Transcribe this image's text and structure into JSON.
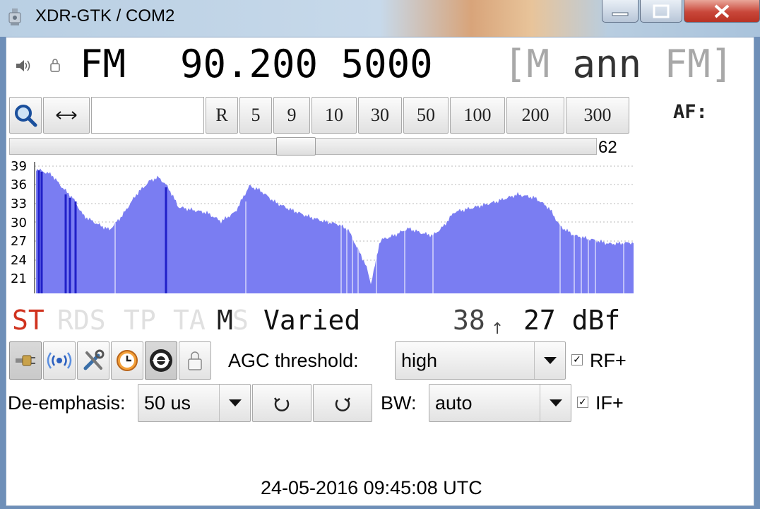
{
  "window": {
    "title": "XDR-GTK / COM2",
    "buttons": {
      "minimize": "minimize-icon",
      "maximize": "maximize-icon",
      "close": "close-icon"
    }
  },
  "tuner": {
    "mode": "FM",
    "frequency": "90.200",
    "pi_code": "5000",
    "station_bracket_open": "[",
    "station_m": "M",
    "station_ann": "ann",
    "station_fm": "FM",
    "station_bracket_close": "]",
    "af_label": "AF:"
  },
  "tune_buttons": {
    "scan_icon": "magnifier-icon",
    "swap_icon": "arrows-horizontal-icon",
    "freq_input_value": "",
    "steps": [
      "R",
      "5",
      "9",
      "10",
      "30",
      "50",
      "100",
      "200",
      "300"
    ]
  },
  "slider": {
    "value": "62"
  },
  "graph": {
    "y_ticks": [
      "39",
      "36",
      "33",
      "30",
      "27",
      "24",
      "21"
    ],
    "color": "#7a7df2",
    "marker_color": "#2020c8"
  },
  "status": {
    "st": "ST",
    "rds": "RDS",
    "tp": "TP",
    "ta": "TA",
    "m": "M",
    "s": "S",
    "ps": "Varied",
    "signal": "38",
    "signal_arrow": "↑",
    "dbf": "27 dBf",
    "st_color": "#d0321e",
    "inactive_color": "#e0e0e0"
  },
  "controls": {
    "icons": [
      "plug-icon",
      "broadcast-icon",
      "tools-icon",
      "clock-icon",
      "rotator-icon",
      "lock-icon"
    ],
    "agc_label": "AGC threshold:",
    "agc_value": "high",
    "rf_label": "RF+",
    "rf_checked": "✓",
    "deemph_label": "De-emphasis:",
    "deemph_value": "50 us",
    "bw_label": "BW:",
    "bw_value": "auto",
    "if_label": "IF+",
    "if_checked": "✓"
  },
  "clock": "24-05-2016 09:45:08 UTC"
}
